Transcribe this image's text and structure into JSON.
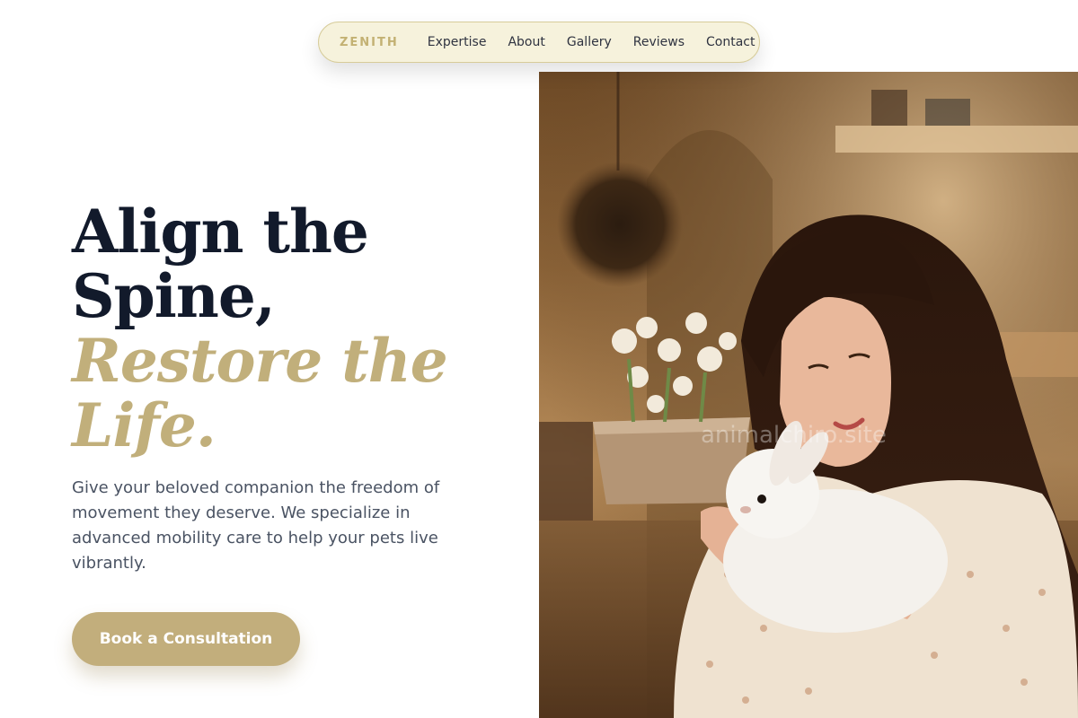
{
  "nav": {
    "brand": "ZENITH",
    "links": [
      "Expertise",
      "About",
      "Gallery",
      "Reviews",
      "Contact"
    ]
  },
  "hero": {
    "title_line1": "Align the",
    "title_line2": "Spine,",
    "accent_line1": "Restore the",
    "accent_line2": "Life.",
    "description": "Give your beloved companion the freedom of movement they deserve. We specialize in advanced mobility care to help your pets live vibrantly.",
    "cta_label": "Book a Consultation",
    "watermark": "animalchiro.site"
  },
  "colors": {
    "accent": "#c1af7b",
    "heading": "#121a2b",
    "nav_bg": "#f6f2dc",
    "cta_bg": "#c2ae7c"
  }
}
